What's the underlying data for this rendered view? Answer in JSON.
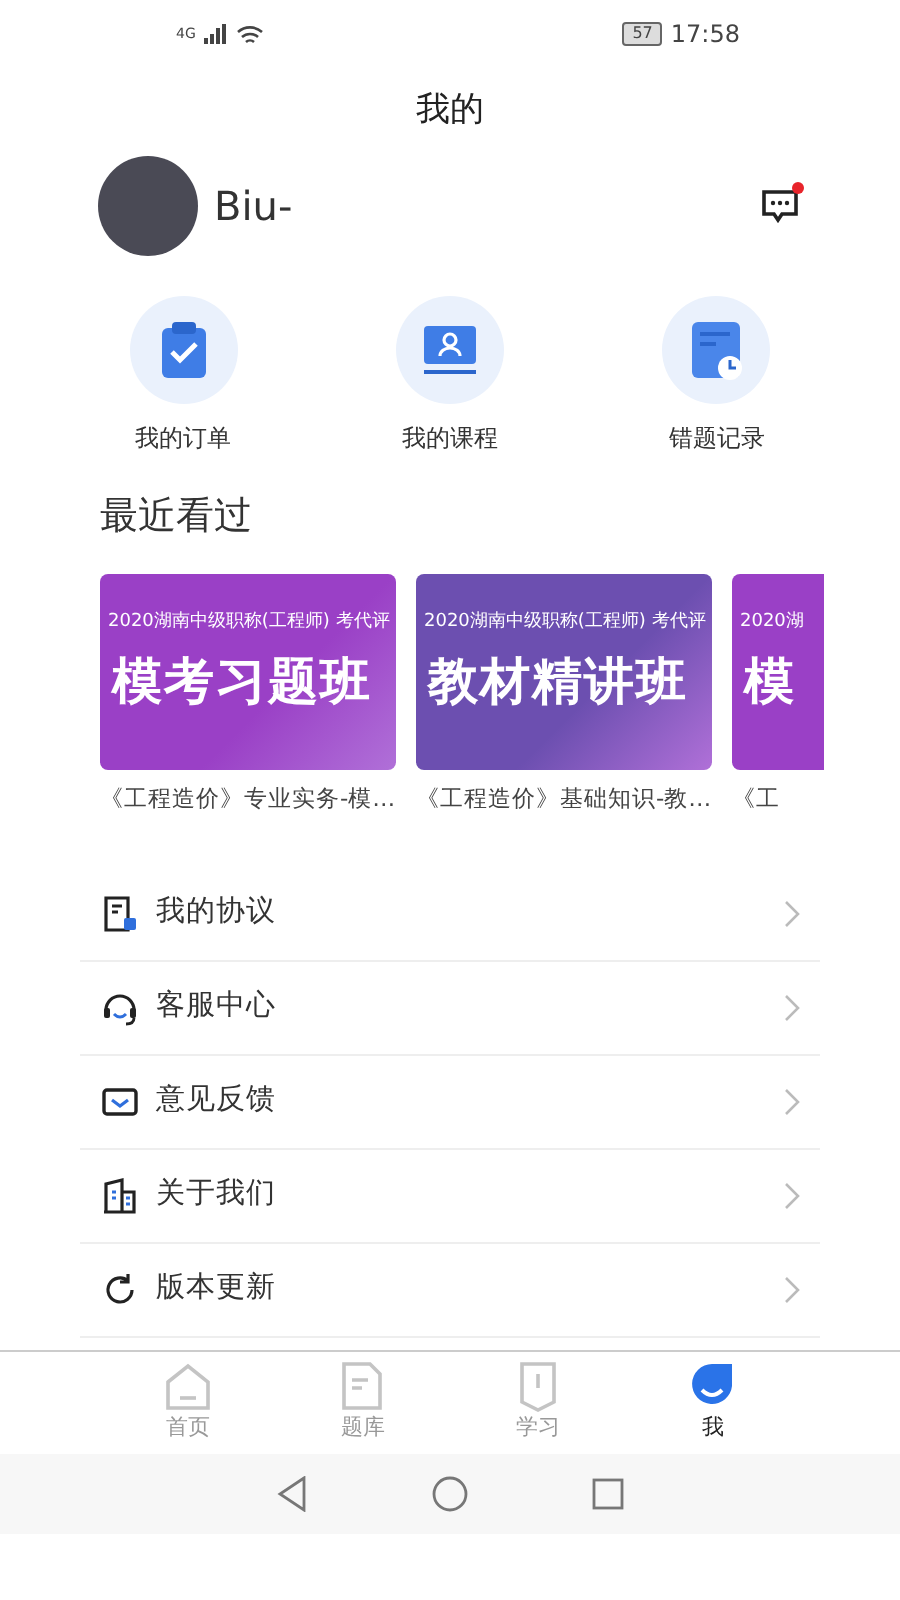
{
  "status_bar": {
    "network": "4G",
    "battery": "57",
    "time": "17:58"
  },
  "header": {
    "title": "我的"
  },
  "profile": {
    "username": "Biu-",
    "message_unread": true
  },
  "shortcuts": [
    {
      "kind": "order",
      "label": "我的订单"
    },
    {
      "kind": "course",
      "label": "我的课程"
    },
    {
      "kind": "mistakes",
      "label": "错题记录"
    }
  ],
  "recent": {
    "heading": "最近看过",
    "courses": [
      {
        "color": "#9a40c6",
        "banner_subtitle": "2020湖南中级职称(工程师) 考代评",
        "banner_title": "模考习题班",
        "caption": "《工程造价》专业实务-模…"
      },
      {
        "color": "#6c4fb0",
        "banner_subtitle": "2020湖南中级职称(工程师) 考代评",
        "banner_title": "教材精讲班",
        "caption": "《工程造价》基础知识-教…"
      },
      {
        "color": "#9a40c6",
        "banner_subtitle": "2020湖",
        "banner_title": "模",
        "caption": "《工"
      }
    ]
  },
  "menu": [
    {
      "kind": "agreement",
      "label": "我的协议"
    },
    {
      "kind": "service",
      "label": "客服中心"
    },
    {
      "kind": "feedback",
      "label": "意见反馈"
    },
    {
      "kind": "about",
      "label": "关于我们"
    },
    {
      "kind": "update",
      "label": "版本更新"
    }
  ],
  "tab_bar": [
    {
      "kind": "home",
      "label": "首页",
      "selected": false
    },
    {
      "kind": "questions",
      "label": "题库",
      "selected": false
    },
    {
      "kind": "study",
      "label": "学习",
      "selected": false
    },
    {
      "kind": "me",
      "label": "我",
      "selected": true
    }
  ]
}
